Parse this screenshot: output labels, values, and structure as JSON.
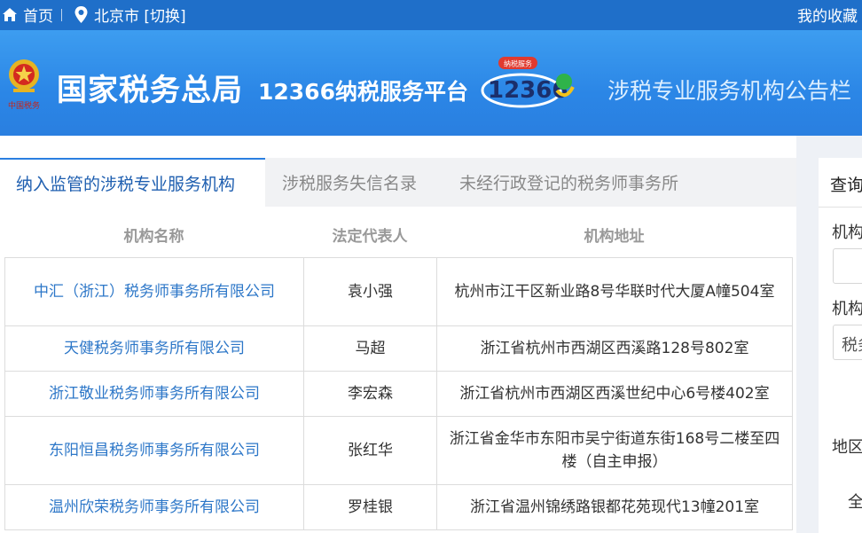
{
  "topbar": {
    "home_label": "首页",
    "city_label": "北京市 [切换]",
    "favorites_label": "我的收藏"
  },
  "banner": {
    "org_name": "国家税务总局",
    "platform_name": "12366纳税服务平台",
    "logo_badge": "纳税服务",
    "logo_number": "12366",
    "emblem_caption": "中国税务",
    "board_title": "涉税专业服务机构公告栏"
  },
  "tabs": [
    {
      "label": "纳入监管的涉税专业服务机构",
      "active": true
    },
    {
      "label": "涉税服务失信名录",
      "active": false
    },
    {
      "label": "未经行政登记的税务师事务所",
      "active": false
    }
  ],
  "table": {
    "headers": [
      "机构名称",
      "法定代表人",
      "机构地址"
    ],
    "rows": [
      {
        "name": "中汇（浙江）税务师事务所有限公司",
        "rep": "袁小强",
        "addr": "杭州市江干区新业路8号华联时代大厦A幢504室"
      },
      {
        "name": "天健税务师事务所有限公司",
        "rep": "马超",
        "addr": "浙江省杭州市西湖区西溪路128号802室"
      },
      {
        "name": "浙江敬业税务师事务所有限公司",
        "rep": "李宏森",
        "addr": "浙江省杭州市西湖区西溪世纪中心6号楼402室"
      },
      {
        "name": "东阳恒昌税务师事务所有限公司",
        "rep": "张红华",
        "addr": "浙江省金华市东阳市吴宁街道东街168号二楼至四楼（自主申报）"
      },
      {
        "name": "温州欣荣税务师事务所有限公司",
        "rep": "罗桂银",
        "addr": "浙江省温州锦绣路银都花苑现代13幢201室"
      }
    ]
  },
  "side_panel": {
    "title": "查询",
    "label_1": "机构",
    "label_2": "机构",
    "select_value": "税务",
    "label_3": "地区",
    "option_text": "全"
  },
  "colors": {
    "topbar": "#1f6fc9",
    "banner": "#2b86e6",
    "link": "#2d77c8",
    "active_tab": "#1f5fb0"
  }
}
